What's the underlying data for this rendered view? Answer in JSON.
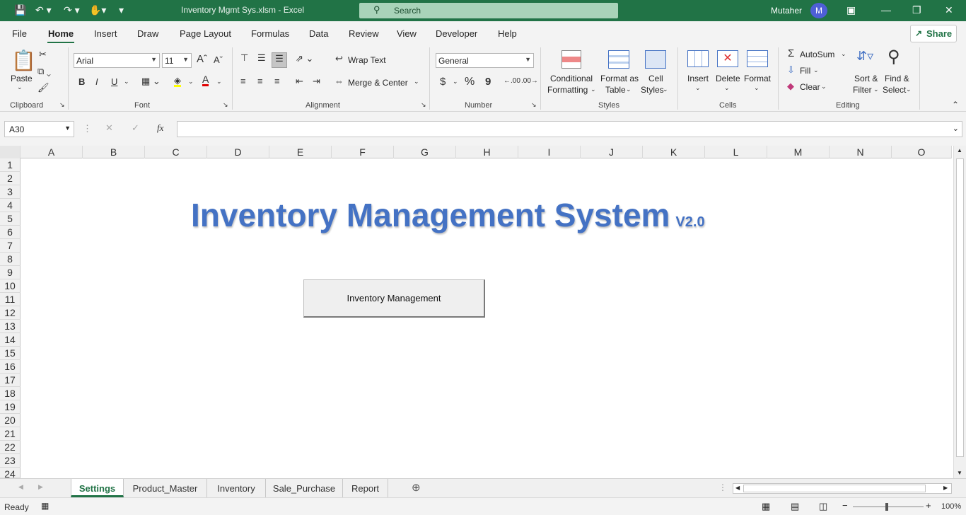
{
  "titlebar": {
    "document_title": "Inventory Mgmt Sys.xlsm  -  Excel",
    "search_placeholder": "Search",
    "user_name": "Mutaher",
    "avatar_initial": "M"
  },
  "menu_tabs": [
    "File",
    "Home",
    "Insert",
    "Draw",
    "Page Layout",
    "Formulas",
    "Data",
    "Review",
    "View",
    "Developer",
    "Help"
  ],
  "share_label": "Share",
  "ribbon": {
    "clipboard": {
      "paste": "Paste",
      "label": "Clipboard"
    },
    "font": {
      "name": "Arial",
      "size": "11",
      "bold": "B",
      "italic": "I",
      "underline": "U",
      "label": "Font"
    },
    "alignment": {
      "wrap_text": "Wrap Text",
      "merge_center": "Merge & Center",
      "label": "Alignment"
    },
    "number": {
      "format": "General",
      "currency": "$",
      "percent": "%",
      "comma": "9",
      "label": "Number"
    },
    "styles": {
      "conditional_1": "Conditional",
      "conditional_2": "Formatting",
      "format_table_1": "Format as",
      "format_table_2": "Table",
      "cell_styles_1": "Cell",
      "cell_styles_2": "Styles",
      "label": "Styles"
    },
    "cells": {
      "insert": "Insert",
      "delete": "Delete",
      "format": "Format",
      "label": "Cells"
    },
    "editing": {
      "autosum": "AutoSum",
      "fill": "Fill",
      "clear": "Clear",
      "sort_1": "Sort &",
      "sort_2": "Filter",
      "find_1": "Find &",
      "find_2": "Select",
      "label": "Editing"
    }
  },
  "formula_bar": {
    "name_box": "A30",
    "formula": "",
    "fx": "fx"
  },
  "columns": [
    "A",
    "B",
    "C",
    "D",
    "E",
    "F",
    "G",
    "H",
    "I",
    "J",
    "K",
    "L",
    "M",
    "N",
    "O"
  ],
  "rows": [
    "1",
    "2",
    "3",
    "4",
    "5",
    "6",
    "7",
    "8",
    "9",
    "10",
    "11",
    "12",
    "13",
    "14",
    "15",
    "16",
    "17",
    "18",
    "19",
    "20",
    "21",
    "22",
    "23",
    "24"
  ],
  "sheet": {
    "title": "Inventory Management System",
    "version": "V2.0",
    "button_label": "Inventory Management"
  },
  "sheet_tabs": [
    "Settings",
    "Product_Master",
    "Inventory",
    "Sale_Purchase",
    "Report"
  ],
  "status": {
    "ready": "Ready",
    "zoom": "100%"
  },
  "colors": {
    "excel_green": "#217346",
    "title_blue": "#4472c4"
  }
}
